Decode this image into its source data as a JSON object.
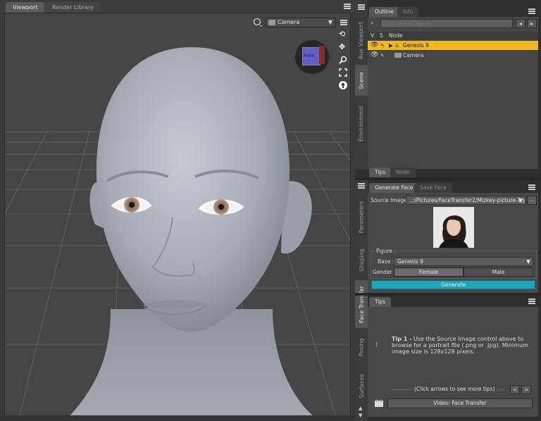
{
  "viewport": {
    "tabs": [
      {
        "label": "Viewport"
      },
      {
        "label": "Render Library"
      }
    ],
    "camera_select": "Camera",
    "nav_cube_label": "Front"
  },
  "side_tabs_top": [
    "Aux Viewport",
    "Scene",
    "Environment"
  ],
  "side_tabs_bottom": [
    "Parameters",
    "Shaping",
    "Face Transfer",
    "Posing",
    "Surfaces"
  ],
  "scene": {
    "tabs": [
      {
        "label": "Outline"
      },
      {
        "label": "Info"
      }
    ],
    "filter_placeholder": "Enter text to filter by...",
    "col_v": "V",
    "col_s": "S",
    "col_node": "Node",
    "nodes": [
      {
        "label": "Genesis 9",
        "selected": true
      },
      {
        "label": "Camera",
        "selected": false
      }
    ],
    "bottom_tabs": [
      {
        "label": "Tips"
      },
      {
        "label": "Node"
      }
    ]
  },
  "face_transfer": {
    "tabs": [
      {
        "label": "Generate Face"
      },
      {
        "label": "Save Face"
      }
    ],
    "source_image_label": "Source Image :",
    "source_image_value": "..:/Pictures/FaceTransfer2/Mizkey-picture-1.jpg",
    "browse_label": "...",
    "figure_label": "Figure :",
    "base_label": "Base :",
    "base_value": "Genesis 9",
    "gender_label": "Gender :",
    "female_label": "Female",
    "male_label": "Male",
    "generate_label": "Generate",
    "accent": "#1aa7b8"
  },
  "tips": {
    "tab": "Tips",
    "tip_title": "Tip 1 -",
    "tip_body": "Use the Source Image control above to browse for a portrait file (.png or .jpg). Minimum image size is 128x128 pixels.",
    "nav_text": "(Click arrows to see more tips)",
    "prev_label": "<",
    "next_label": ">",
    "video_label": "Video: Face Transfer"
  }
}
